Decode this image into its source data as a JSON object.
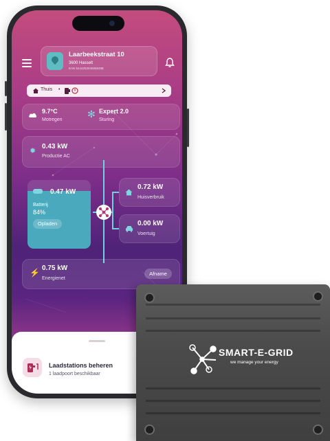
{
  "header": {
    "street": "Laarbeekstraat 10",
    "city": "3600 Hasselt",
    "ean": "EAN 5444253045558488",
    "icons": {
      "menu": "hamburger-icon",
      "location": "location-pin-icon",
      "notifications": "bell-icon"
    }
  },
  "breadcrumb": {
    "home_label": "Thuis",
    "separator": "•"
  },
  "weather": {
    "temperature": "9.7°C",
    "condition": "Motregen"
  },
  "control": {
    "mode": "Expert 2.0",
    "label": "Sturing"
  },
  "production": {
    "value": "0.43 kW",
    "label": "Productie AC"
  },
  "battery": {
    "value": "0.47 kW",
    "label": "Batterij",
    "percent": "84%",
    "level": 84,
    "action": "Opladen"
  },
  "house": {
    "value": "0.72 kW",
    "label": "Huisverbruik"
  },
  "vehicle": {
    "value": "0.00 kW",
    "label": "Voertuig"
  },
  "grid": {
    "value": "0.75 kW",
    "label": "Energienet",
    "direction": "Afname"
  },
  "sheet": {
    "title": "Laadstations beheren",
    "subtitle": "1 laadpoort beschikbaar"
  },
  "device": {
    "brand": "SMART-E-GRID",
    "tagline": "we manage your energy"
  },
  "colors": {
    "accent": "#6fd2df",
    "battery_fill": "#4aa9bd",
    "gradient_top": "#c44c7e",
    "gradient_mid": "#4e2378"
  }
}
